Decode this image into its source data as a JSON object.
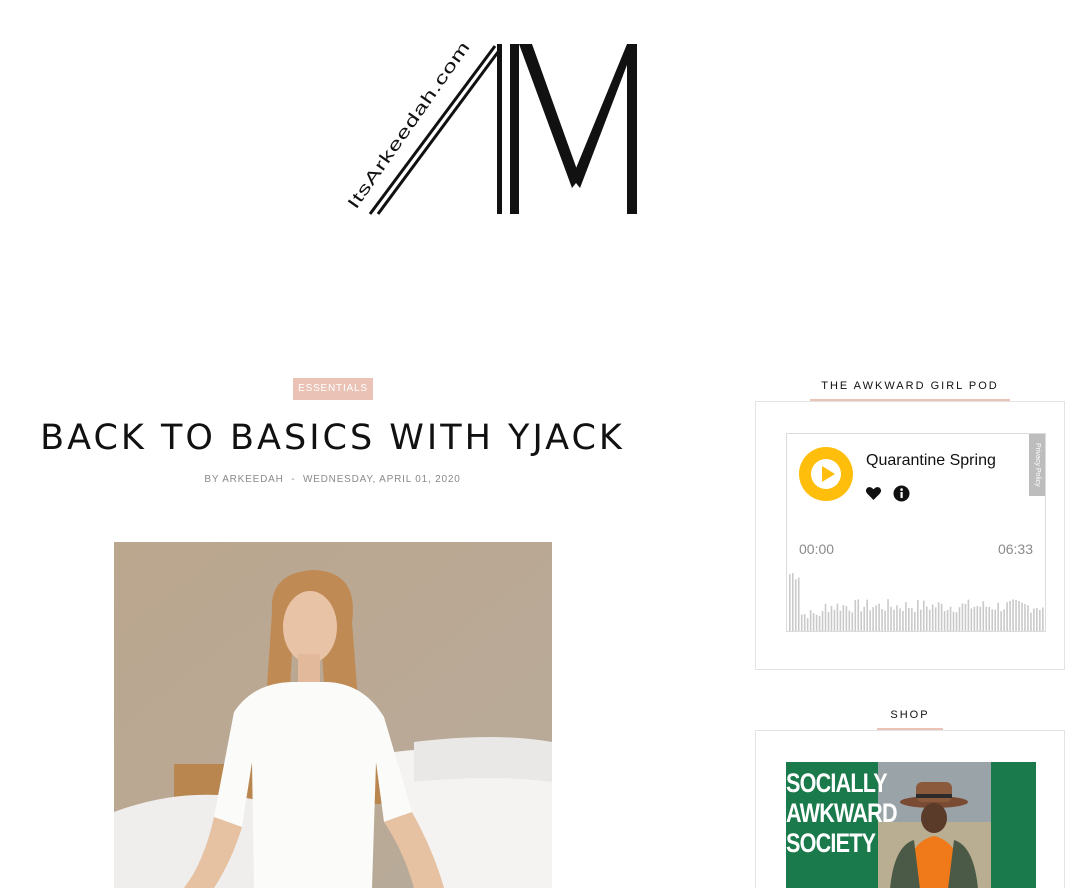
{
  "logo": {
    "domain_text": "ItsArkeedah.com",
    "monogram": "AM"
  },
  "post": {
    "category": "ESSENTIALS",
    "title": "BACK TO BASICS WITH YJACK",
    "meta_prefix": "BY",
    "author": "ARKEEDAH",
    "separator": "-",
    "date": "WEDNESDAY, APRIL 01, 2020"
  },
  "sidebar": {
    "podcast": {
      "widget_title": "THE AWKWARD GIRL POD",
      "episode_title": "Quarantine Spring",
      "time_elapsed": "00:00",
      "time_total": "06:33",
      "privacy_label": "Privacy Policy",
      "accent_color": "#ffbe0b"
    },
    "shop": {
      "widget_title": "SHOP",
      "banner_lines": [
        "SOCIALLY",
        "AWKWARD",
        "SOCIETY"
      ],
      "banner_color": "#1a7a4c"
    }
  },
  "colors": {
    "accent_pink": "#eac2b6",
    "meta_gray": "#8a8a8a"
  },
  "icons": {
    "play": "play-icon",
    "heart": "heart-icon",
    "info": "info-icon"
  }
}
